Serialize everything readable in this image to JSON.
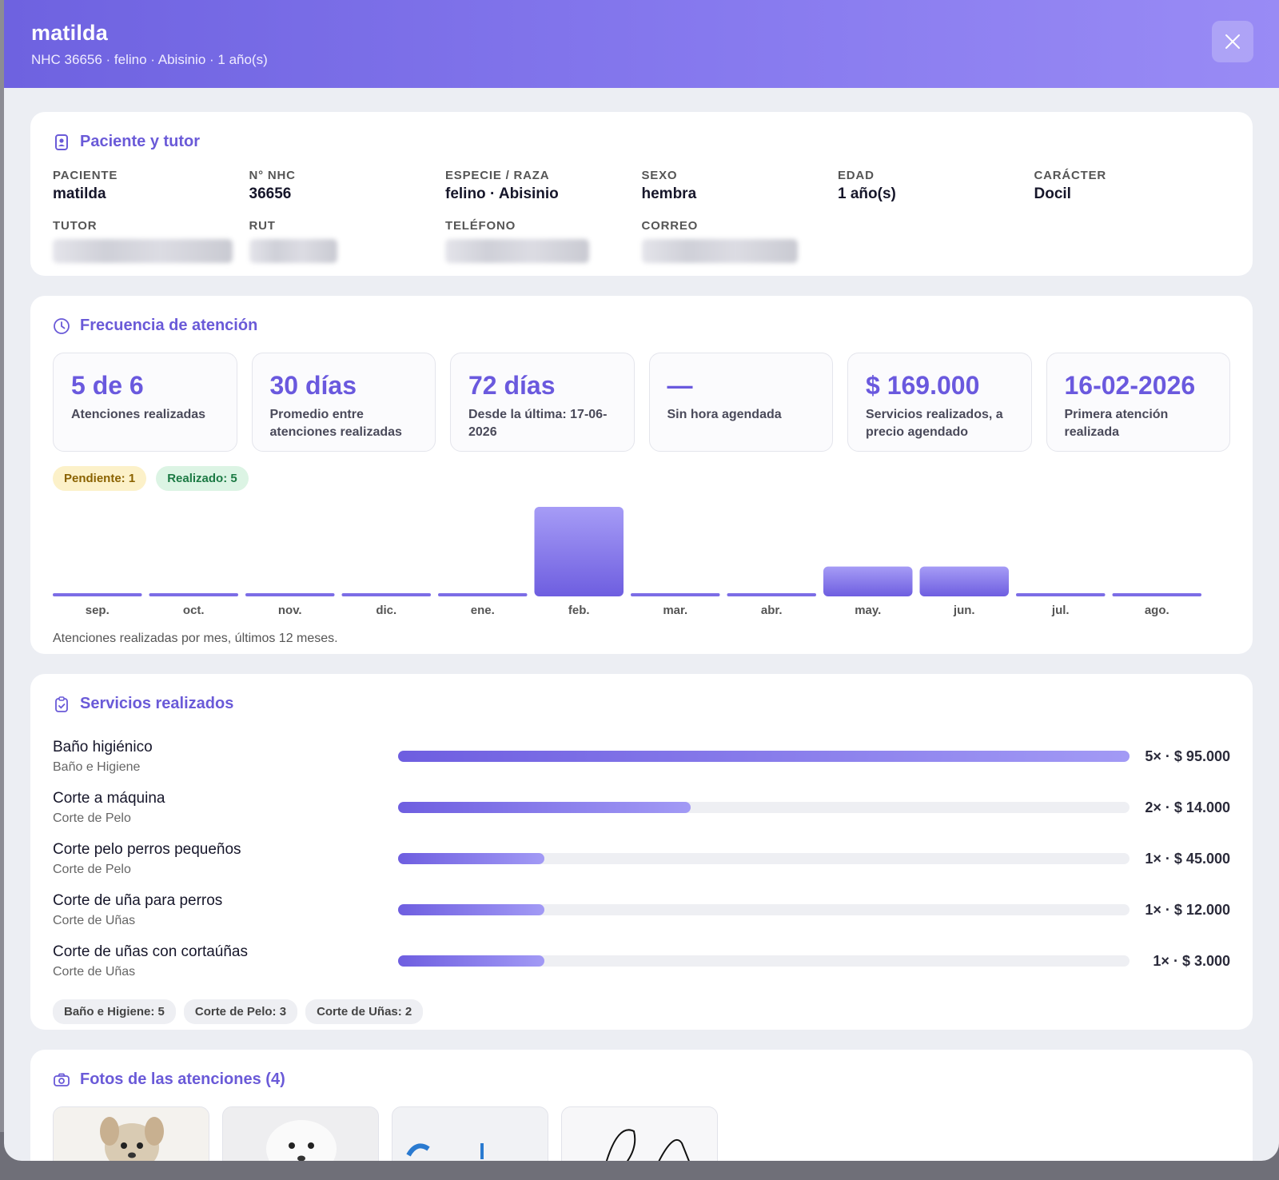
{
  "header": {
    "title": "matilda",
    "subtitle": "NHC 36656 · felino · Abisinio · 1 año(s)"
  },
  "patient": {
    "title": "Paciente y tutor",
    "fields": [
      {
        "label": "PACIENTE",
        "value": "matilda"
      },
      {
        "label": "N° NHC",
        "value": "36656"
      },
      {
        "label": "ESPECIE / RAZA",
        "value": "felino · Abisinio"
      },
      {
        "label": "SEXO",
        "value": "hembra"
      },
      {
        "label": "EDAD",
        "value": "1 año(s)"
      },
      {
        "label": "CARÁCTER",
        "value": "Docil"
      }
    ],
    "contact_labels": [
      "TUTOR",
      "RUT",
      "TELÉFONO",
      "CORREO"
    ]
  },
  "frequency": {
    "title": "Frecuencia de atención",
    "stats": [
      {
        "value": "5 de 6",
        "label": "Atenciones realizadas"
      },
      {
        "value": "30 días",
        "label": "Promedio entre atenciones realizadas"
      },
      {
        "value": "72 días",
        "label": "Desde la última: 17-06-2026"
      },
      {
        "value": "—",
        "label": "Sin hora agendada"
      },
      {
        "value": "$ 169.000",
        "label": "Servicios realizados, a precio agendado"
      },
      {
        "value": "16-02-2026",
        "label": "Primera atención realizada"
      }
    ],
    "pending_label": "Pendiente: 1",
    "done_label": "Realizado: 5",
    "caption": "Atenciones realizadas por mes, últimos 12 meses."
  },
  "chart_data": {
    "type": "bar",
    "categories": [
      "sep.",
      "oct.",
      "nov.",
      "dic.",
      "ene.",
      "feb.",
      "mar.",
      "abr.",
      "may.",
      "jun.",
      "jul.",
      "ago."
    ],
    "values": [
      0,
      0,
      0,
      0,
      0,
      3,
      0,
      0,
      1,
      1,
      0,
      0
    ],
    "title": "",
    "xlabel": "",
    "ylabel": "",
    "ylim": [
      0,
      3
    ],
    "grid": false,
    "bar_color": "#6e5ee0"
  },
  "services": {
    "title": "Servicios realizados",
    "items": [
      {
        "name": "Baño higiénico",
        "category": "Baño e Higiene",
        "amount": "5× · $ 95.000",
        "share": 1.0
      },
      {
        "name": "Corte a máquina",
        "category": "Corte de Pelo",
        "amount": "2× · $ 14.000",
        "share": 0.4
      },
      {
        "name": "Corte pelo perros pequeños",
        "category": "Corte de Pelo",
        "amount": "1× · $ 45.000",
        "share": 0.2
      },
      {
        "name": "Corte de uña para perros",
        "category": "Corte de Uñas",
        "amount": "1× · $ 12.000",
        "share": 0.2
      },
      {
        "name": "Corte de uñas con cortaúñas",
        "category": "Corte de Uñas",
        "amount": "1× · $ 3.000",
        "share": 0.2
      }
    ],
    "tags": [
      "Baño e Higiene: 5",
      "Corte de Pelo: 3",
      "Corte de Uñas: 2"
    ]
  },
  "photos": {
    "title": "Fotos de las atenciones (4)"
  },
  "colors": {
    "accent": "#6a5ad8",
    "header_start": "#6e62e0",
    "header_end": "#998bf5"
  }
}
